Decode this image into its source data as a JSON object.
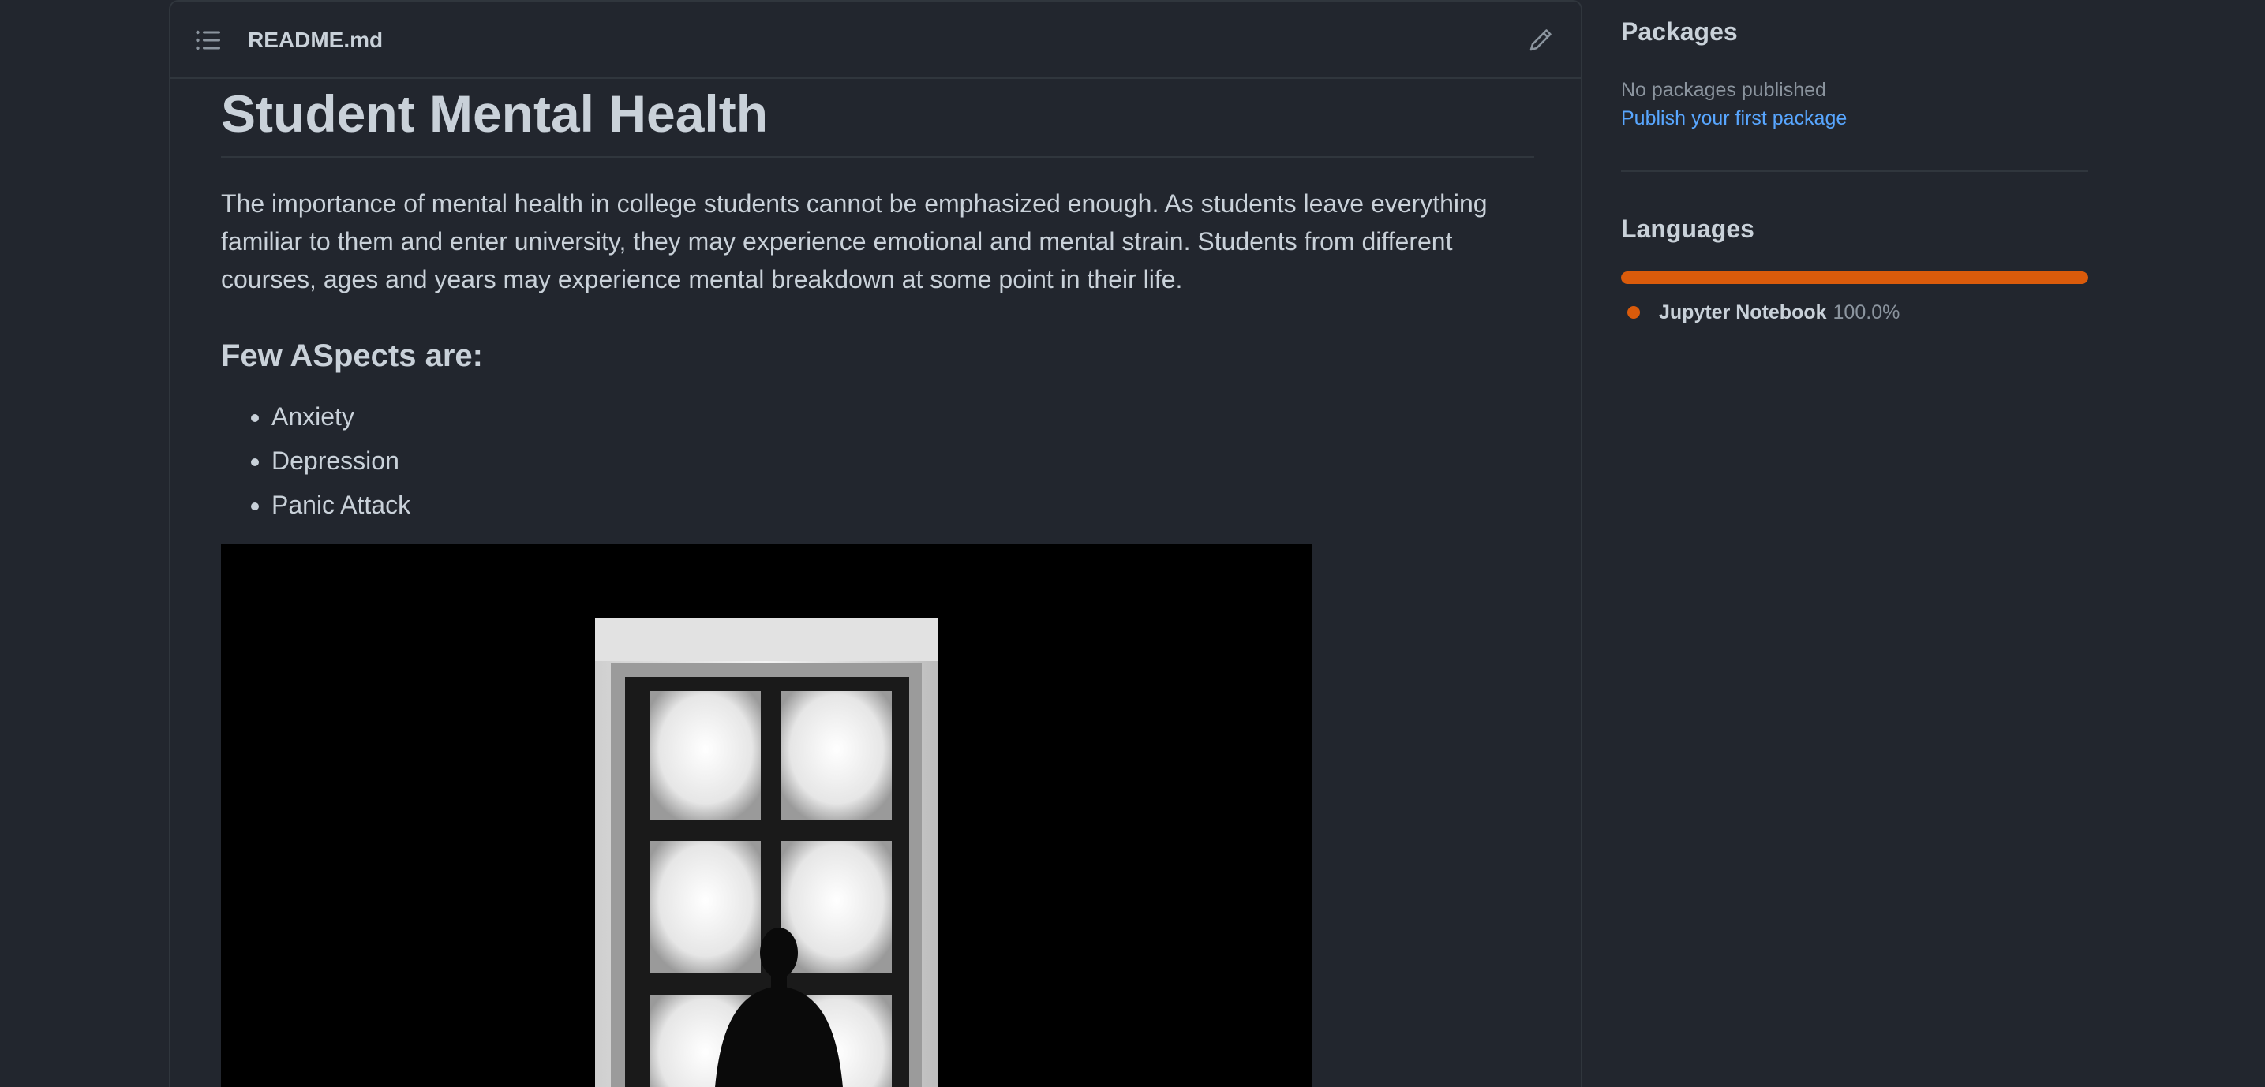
{
  "readme": {
    "filename": "README.md",
    "title": "Student Mental Health",
    "intro": "The importance of mental health in college students cannot be emphasized enough. As students leave everything familiar to them and enter university, they may experience emotional and mental strain. Students from different courses, ages and years may experience mental breakdown at some point in their life.",
    "subheading": "Few ASpects are:",
    "aspects": [
      "Anxiety",
      "Depression",
      "Panic Attack"
    ],
    "image_description": "person silhouette looking out a bright window"
  },
  "sidebar": {
    "packages": {
      "heading": "Packages",
      "status": "No packages published",
      "link": "Publish your first package"
    },
    "languages": {
      "heading": "Languages",
      "items": [
        {
          "name": "Jupyter Notebook",
          "percent_label": "100.0%",
          "percent": 100,
          "color": "#DA5B0B"
        }
      ]
    }
  },
  "icons": {
    "toc": "list-unordered-icon",
    "edit": "pencil-icon"
  }
}
